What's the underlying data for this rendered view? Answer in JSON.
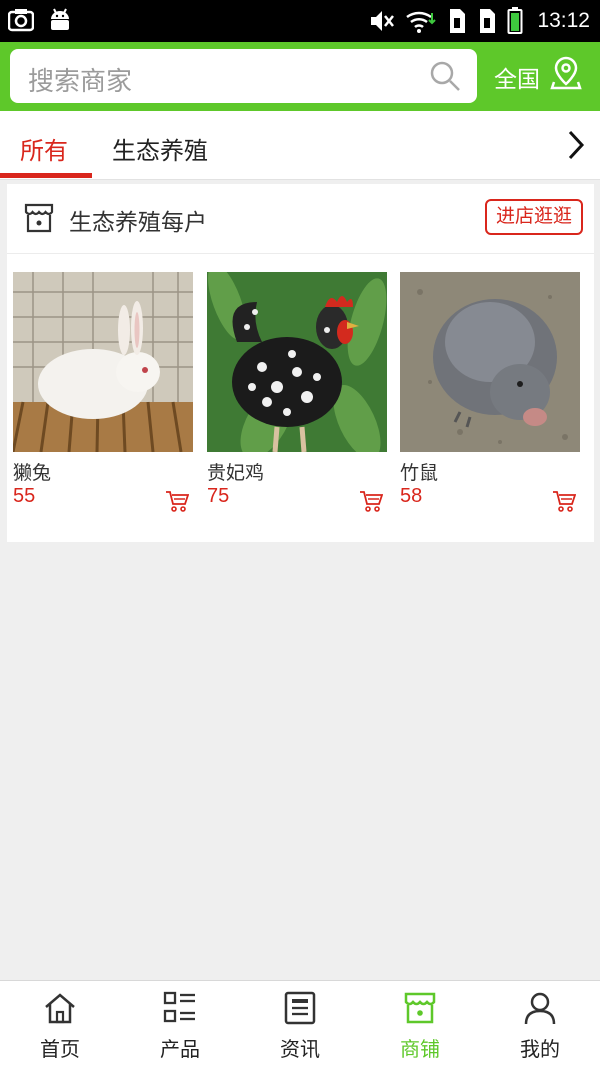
{
  "status_bar": {
    "time": "13:12",
    "icons": [
      "screenshot-icon",
      "android-icon",
      "mute-icon",
      "wifi-icon",
      "sim1-icon",
      "sim2-icon",
      "battery-icon"
    ]
  },
  "header": {
    "search_placeholder": "搜索商家",
    "region_label": "全国",
    "accent_color": "#5ec82a"
  },
  "tabs": {
    "items": [
      {
        "label": "所有",
        "active": true
      },
      {
        "label": "生态养殖",
        "active": false
      }
    ]
  },
  "store": {
    "name": "生态养殖每户",
    "visit_label": "进店逛逛",
    "products": [
      {
        "name": "獭兔",
        "price": "55",
        "image": "white rabbit in cage"
      },
      {
        "name": "贵妃鸡",
        "price": "75",
        "image": "speckled rooster"
      },
      {
        "name": "竹鼠",
        "price": "58",
        "image": "grey bamboo rat"
      }
    ]
  },
  "bottom_nav": {
    "items": [
      {
        "label": "首页",
        "icon": "home-icon"
      },
      {
        "label": "产品",
        "icon": "products-grid-icon"
      },
      {
        "label": "资讯",
        "icon": "news-icon"
      },
      {
        "label": "商铺",
        "icon": "store-icon"
      },
      {
        "label": "我的",
        "icon": "profile-icon"
      }
    ],
    "active_index": 3,
    "active_color": "#5ec82a"
  },
  "price_color": "#d9261c"
}
